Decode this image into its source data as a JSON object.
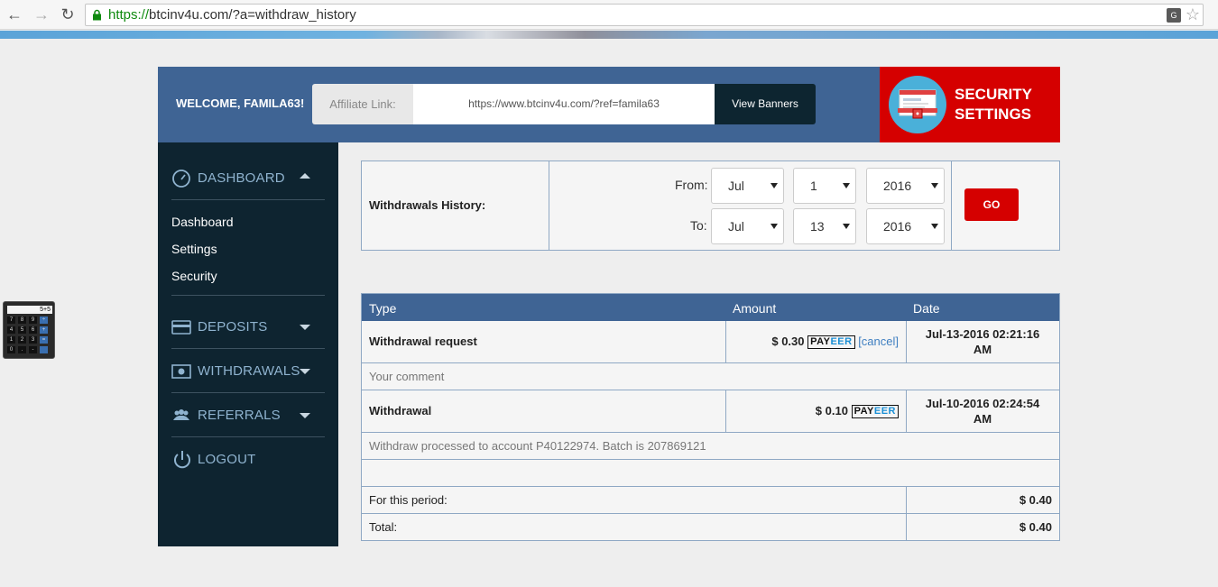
{
  "browser": {
    "url_scheme": "https://",
    "url_rest": "btcinv4u.com/?a=withdraw_history"
  },
  "header": {
    "welcome": "WELCOME, FAMILA63!",
    "affiliate_label": "Affiliate Link:",
    "affiliate_url": "https://www.btcinv4u.com/?ref=famila63",
    "view_banners": "View Banners",
    "security_line1": "SECURITY",
    "security_line2": "SETTINGS"
  },
  "sidebar": {
    "dashboard": "DASHBOARD",
    "sub_items": [
      "Dashboard",
      "Settings",
      "Security"
    ],
    "deposits": "DEPOSITS",
    "withdrawals": "WITHDRAWALS",
    "referrals": "REFERRALS",
    "logout": "LOGOUT"
  },
  "calculator": {
    "display": "5+5",
    "keys": [
      "7",
      "8",
      "9",
      "÷",
      "4",
      "5",
      "6",
      "+",
      "1",
      "2",
      "3",
      "=",
      "0",
      ".",
      "-",
      ""
    ]
  },
  "filter": {
    "title": "Withdrawals History:",
    "from_label": "From:",
    "to_label": "To:",
    "from_month": "Jul",
    "from_day": "1",
    "from_year": "2016",
    "to_month": "Jul",
    "to_day": "13",
    "to_year": "2016",
    "go": "GO"
  },
  "history": {
    "col_type": "Type",
    "col_amount": "Amount",
    "col_date": "Date",
    "rows": [
      {
        "type": "Withdrawal request",
        "amount": "$ 0.30",
        "cancel": "[cancel]",
        "date_line1": "Jul-13-2016 02:21:16",
        "date_line2": "AM",
        "comment": "Your comment"
      },
      {
        "type": "Withdrawal",
        "amount": "$ 0.10",
        "date_line1": "Jul-10-2016 02:24:54",
        "date_line2": "AM",
        "comment": "Withdraw processed to account P40122974. Batch is 207869121"
      }
    ],
    "period_label": "For this period:",
    "period_value": "$ 0.40",
    "total_label": "Total:",
    "total_value": "$ 0.40",
    "payeer_pay": "PAY",
    "payeer_eer": "EER"
  },
  "colors": {
    "header_blue": "#3f6494",
    "sidebar_dark": "#0e2430",
    "accent_red": "#d50000"
  }
}
